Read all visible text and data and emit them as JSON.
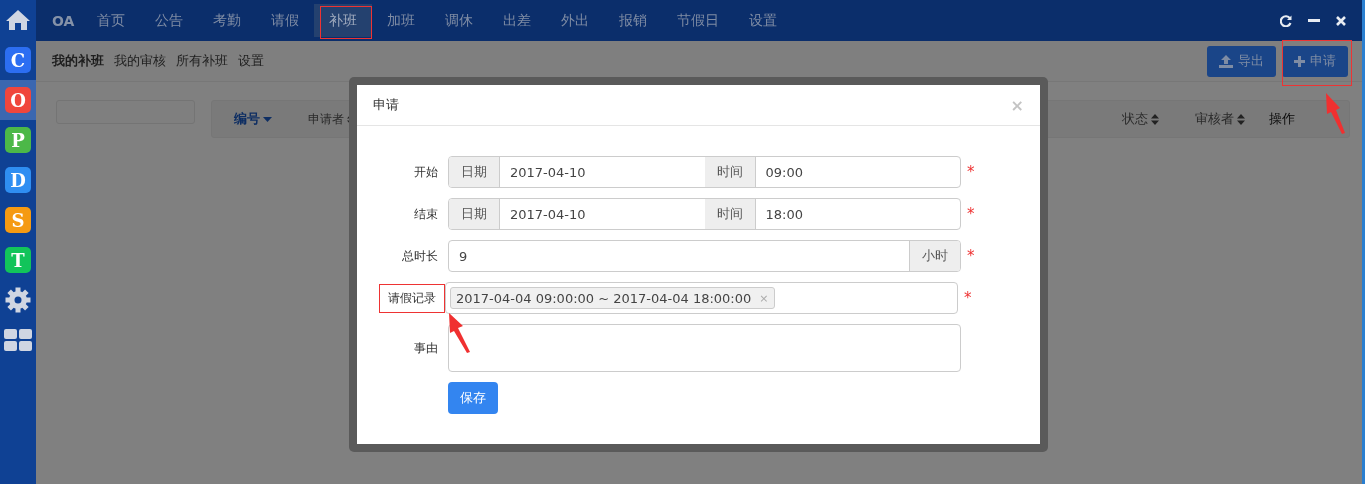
{
  "sidebar": {
    "items": [
      {
        "kind": "home",
        "selected": false
      },
      {
        "kind": "app",
        "letter": "C",
        "color": "#2c6ef2",
        "selected": false
      },
      {
        "kind": "app",
        "letter": "O",
        "color": "#f0463c",
        "selected": true
      },
      {
        "kind": "app",
        "letter": "P",
        "color": "#4cb848",
        "selected": false
      },
      {
        "kind": "app",
        "letter": "D",
        "color": "#2f8ef2",
        "selected": false
      },
      {
        "kind": "app",
        "letter": "S",
        "color": "#f59a12",
        "selected": false
      },
      {
        "kind": "app",
        "letter": "T",
        "color": "#12c45a",
        "selected": false
      },
      {
        "kind": "settings",
        "selected": false
      },
      {
        "kind": "grid",
        "selected": false
      }
    ]
  },
  "top_nav": {
    "brand": "OA",
    "items": [
      {
        "label": "首页",
        "selected": false
      },
      {
        "label": "公告",
        "selected": false
      },
      {
        "label": "考勤",
        "selected": false
      },
      {
        "label": "请假",
        "selected": false
      },
      {
        "label": "补班",
        "selected": true
      },
      {
        "label": "加班",
        "selected": false
      },
      {
        "label": "调休",
        "selected": false
      },
      {
        "label": "出差",
        "selected": false
      },
      {
        "label": "外出",
        "selected": false
      },
      {
        "label": "报销",
        "selected": false
      },
      {
        "label": "节假日",
        "selected": false
      },
      {
        "label": "设置",
        "selected": false
      }
    ],
    "window_controls": [
      {
        "kind": "refresh"
      },
      {
        "kind": "minimize"
      },
      {
        "kind": "close"
      }
    ]
  },
  "sub_nav": {
    "items": [
      {
        "label": "我的补班",
        "selected": true
      },
      {
        "label": "我的审核",
        "selected": false
      },
      {
        "label": "所有补班",
        "selected": false
      },
      {
        "label": "设置",
        "selected": false
      }
    ],
    "buttons": [
      {
        "kind": "export",
        "label": "导出"
      },
      {
        "kind": "add",
        "label": "申请"
      }
    ]
  },
  "table": {
    "columns": [
      {
        "label": "编号",
        "sortable": true,
        "sorted": true
      },
      {
        "label": "申请者",
        "sortable": true,
        "sorted": false
      },
      {
        "label": "状态",
        "sortable": true,
        "sorted": false
      },
      {
        "label": "审核者",
        "sortable": true,
        "sorted": false
      },
      {
        "label": "操作",
        "sortable": false,
        "sorted": false
      }
    ]
  },
  "dialog": {
    "title": "申请",
    "close": "×",
    "rows": [
      {
        "kind": "datetime",
        "label": "开始",
        "date_addon": "日期",
        "date": "2017-04-10",
        "time_addon": "时间",
        "time": "09:00",
        "required_mark": "*"
      },
      {
        "kind": "datetime",
        "label": "结束",
        "date_addon": "日期",
        "date": "2017-04-10",
        "time_addon": "时间",
        "time": "18:00",
        "required_mark": "*"
      },
      {
        "kind": "number",
        "label": "总时长",
        "value": "9",
        "unit": "小时",
        "required_mark": "*"
      },
      {
        "kind": "tags",
        "label": "请假记录",
        "tags": [
          {
            "text": "2017-04-04 09:00:00 ~ 2017-04-04 18:00:00",
            "remove": "×"
          }
        ],
        "required_mark": "*"
      },
      {
        "kind": "textarea",
        "label": "事由"
      }
    ],
    "save_button": "保存"
  }
}
